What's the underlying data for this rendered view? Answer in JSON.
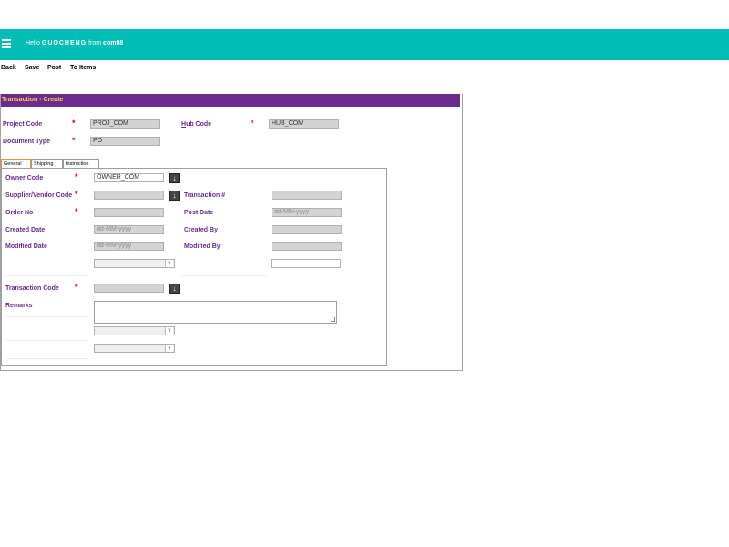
{
  "topbar": {
    "hello": "Hello",
    "user": "GUOCHENG",
    "from": "from",
    "company": "com08"
  },
  "toolbar": {
    "back": "Back",
    "save": "Save",
    "post": "Post",
    "to_items": "To Items"
  },
  "panel": {
    "title": "Transaction - Create"
  },
  "header_fields": {
    "project_code_label": "Project Code",
    "project_code_value": "PROJ_COM",
    "hub_code_label_first": "H",
    "hub_code_label_rest": "ub Code",
    "hub_code_value": "HUB_COM",
    "document_type_label": "Document Type",
    "document_type_value": "PO",
    "required_mark": "*"
  },
  "tabs": [
    "General",
    "Shipping",
    "Instruction"
  ],
  "general": {
    "owner_code_label": "Owner Code",
    "owner_code_value": "OWNER_COM",
    "supplier_vendor_label": "Supplier/Vendor Code",
    "transaction_no_label": "Transaction #",
    "order_no_label": "Order No",
    "post_date_label": "Post Date",
    "post_date_placeholder": "dd-MM-yyyy",
    "created_date_label": "Created Date",
    "created_date_placeholder": "dd-MM-yyyy",
    "created_by_label": "Created By",
    "modified_date_label": "Modified Date",
    "modified_date_placeholder": "dd-MM-yyyy",
    "modified_by_label": "Modified By",
    "transaction_code_label": "Transaction Code",
    "remarks_label": "Remarks"
  },
  "icons": {
    "menu": "hamburger-icon",
    "lookup": "arrow-down-icon",
    "dropdown": "chevron-down-icon"
  },
  "colors": {
    "topbar": "#00bdb5",
    "panel_header": "#6b2a8e",
    "panel_title": "#ffd24a",
    "label": "#6b2a8e",
    "required": "#e00000"
  }
}
